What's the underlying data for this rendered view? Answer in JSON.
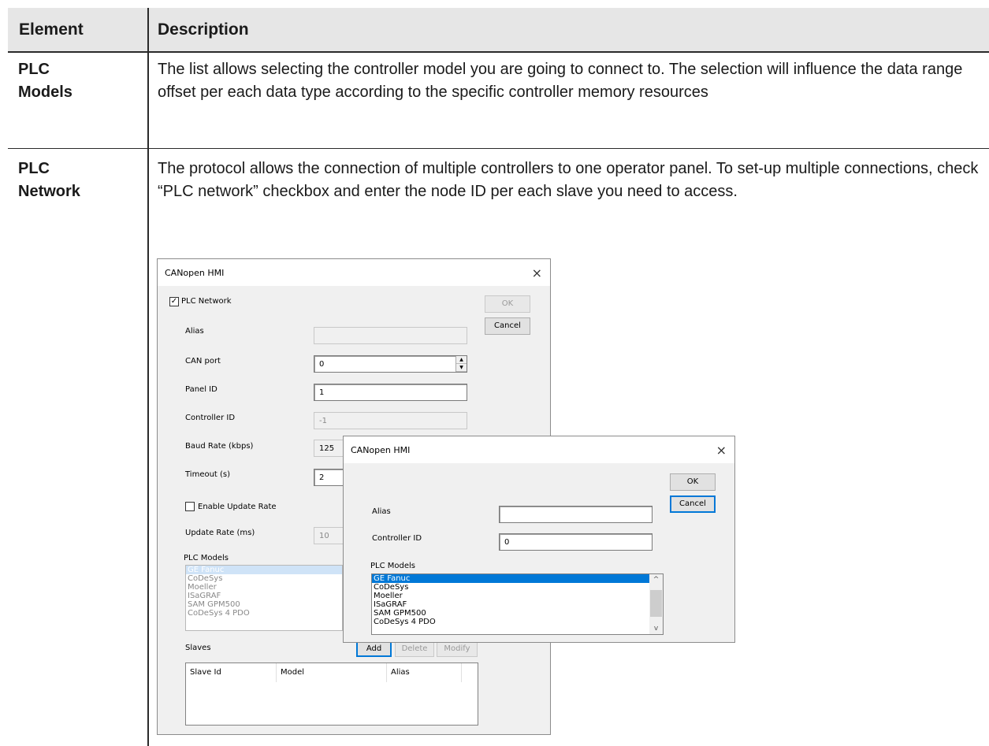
{
  "table": {
    "col_element": "Element",
    "col_description": "Description",
    "rows": [
      {
        "element_line1": "PLC",
        "element_line2": "Models",
        "description": "The list allows selecting the controller model you are going to connect to. The selection will influence the data range offset per each data type according to the specific controller memory resources"
      },
      {
        "element_line1": "PLC",
        "element_line2": "Network",
        "description": "The protocol allows the connection of multiple controllers to one operator panel. To set-up multiple connections, check “PLC network” checkbox and enter the node ID per each slave you need to access."
      }
    ]
  },
  "dialog1": {
    "title": "CANopen HMI",
    "close": "×",
    "plc_network_label": "PLC Network",
    "plc_network_checked": "✓",
    "ok": "OK",
    "cancel": "Cancel",
    "alias_label": "Alias",
    "alias_value": "",
    "can_port_label": "CAN port",
    "can_port_value": "0",
    "panel_id_label": "Panel ID",
    "panel_id_value": "1",
    "controller_id_label": "Controller ID",
    "controller_id_value": "-1",
    "baud_label": "Baud Rate (kbps)",
    "baud_value": "125",
    "timeout_label": "Timeout (s)",
    "timeout_value": "2",
    "enable_update_label": "Enable Update Rate",
    "update_rate_label": "Update Rate (ms)",
    "update_rate_value": "10",
    "plc_models_label": "PLC Models",
    "models": [
      "GE Fanuc",
      "CoDeSys",
      "Moeller",
      "ISaGRAF",
      "SAM GPM500",
      "CoDeSys 4 PDO"
    ],
    "slaves_label": "Slaves",
    "add": "Add",
    "delete": "Delete",
    "modify": "Modify",
    "col_slave_id": "Slave Id",
    "col_model": "Model",
    "col_alias": "Alias"
  },
  "dialog2": {
    "title": "CANopen HMI",
    "close": "×",
    "ok": "OK",
    "cancel": "Cancel",
    "alias_label": "Alias",
    "alias_value": "",
    "controller_id_label": "Controller ID",
    "controller_id_value": "0",
    "plc_models_label": "PLC Models",
    "models": [
      "GE Fanuc",
      "CoDeSys",
      "Moeller",
      "ISaGRAF",
      "SAM GPM500",
      "CoDeSys 4 PDO"
    ]
  },
  "colors": {
    "header_bg": "#e6e6e6",
    "selection": "#0078d7"
  }
}
